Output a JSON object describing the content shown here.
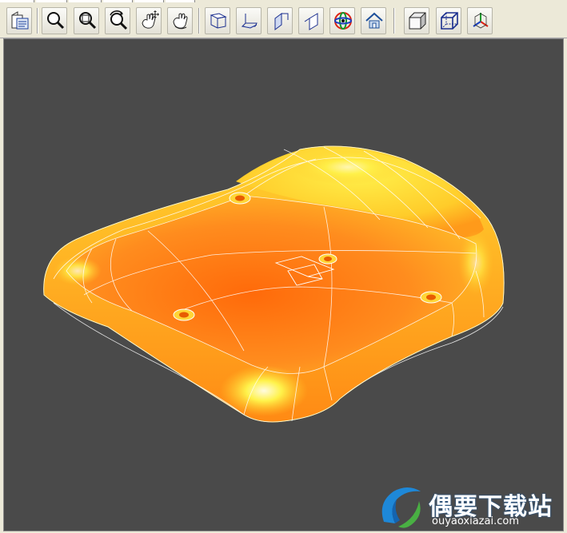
{
  "toolbar": {
    "buttons": [
      {
        "name": "print-preview-button",
        "icon": "document-view-icon"
      },
      {
        "name": "zoom-button",
        "icon": "magnifier-icon"
      },
      {
        "name": "zoom-window-button",
        "icon": "zoom-window-icon"
      },
      {
        "name": "zoom-dynamic-button",
        "icon": "zoom-rotate-icon"
      },
      {
        "name": "pan-button",
        "icon": "hand-pan-icon"
      },
      {
        "name": "rotate-button",
        "icon": "hand-rotate-icon"
      },
      {
        "name": "view-top-button",
        "icon": "view-top-icon"
      },
      {
        "name": "view-bottom-button",
        "icon": "view-bottom-icon"
      },
      {
        "name": "view-left-button",
        "icon": "view-left-icon"
      },
      {
        "name": "view-right-button",
        "icon": "view-right-icon"
      },
      {
        "name": "view-orbit-button",
        "icon": "orbit-icon"
      },
      {
        "name": "view-home-button",
        "icon": "home-icon"
      },
      {
        "name": "shaded-button",
        "icon": "shaded-cube-icon"
      },
      {
        "name": "wireframe-button",
        "icon": "wireframe-cube-icon"
      },
      {
        "name": "axes-button",
        "icon": "axes-icon"
      }
    ]
  },
  "viewport": {
    "background": "#4a4a4a",
    "model_color": "#ff8a1a",
    "highlight_color": "#ffe93a"
  },
  "watermark": {
    "title": "偶要下载站",
    "url": "ouyaoxiazai.com"
  }
}
